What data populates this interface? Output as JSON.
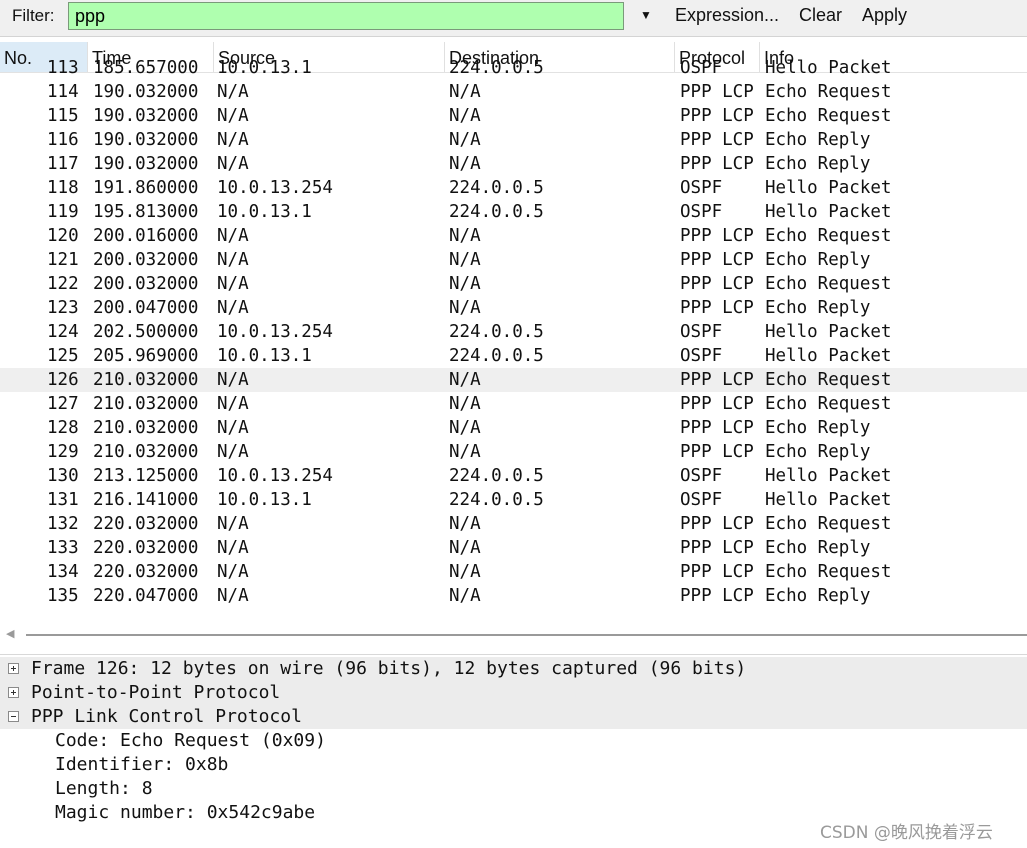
{
  "toolbar": {
    "filter_label": "Filter:",
    "filter_value": "ppp",
    "expression": "Expression...",
    "clear": "Clear",
    "apply": "Apply"
  },
  "columns": {
    "no": "No.",
    "time": "Time",
    "source": "Source",
    "destination": "Destination",
    "protocol": "Protocol",
    "info": "Info"
  },
  "packets": [
    {
      "no": "113",
      "time": "185.657000",
      "source": "10.0.13.1",
      "destination": "224.0.0.5",
      "protocol": "OSPF",
      "info": "Hello Packet"
    },
    {
      "no": "114",
      "time": "190.032000",
      "source": "N/A",
      "destination": "N/A",
      "protocol": "PPP LCP",
      "info": "Echo Request"
    },
    {
      "no": "115",
      "time": "190.032000",
      "source": "N/A",
      "destination": "N/A",
      "protocol": "PPP LCP",
      "info": "Echo Request"
    },
    {
      "no": "116",
      "time": "190.032000",
      "source": "N/A",
      "destination": "N/A",
      "protocol": "PPP LCP",
      "info": "Echo Reply"
    },
    {
      "no": "117",
      "time": "190.032000",
      "source": "N/A",
      "destination": "N/A",
      "protocol": "PPP LCP",
      "info": "Echo Reply"
    },
    {
      "no": "118",
      "time": "191.860000",
      "source": "10.0.13.254",
      "destination": "224.0.0.5",
      "protocol": "OSPF",
      "info": "Hello Packet"
    },
    {
      "no": "119",
      "time": "195.813000",
      "source": "10.0.13.1",
      "destination": "224.0.0.5",
      "protocol": "OSPF",
      "info": "Hello Packet"
    },
    {
      "no": "120",
      "time": "200.016000",
      "source": "N/A",
      "destination": "N/A",
      "protocol": "PPP LCP",
      "info": "Echo Request"
    },
    {
      "no": "121",
      "time": "200.032000",
      "source": "N/A",
      "destination": "N/A",
      "protocol": "PPP LCP",
      "info": "Echo Reply"
    },
    {
      "no": "122",
      "time": "200.032000",
      "source": "N/A",
      "destination": "N/A",
      "protocol": "PPP LCP",
      "info": "Echo Request"
    },
    {
      "no": "123",
      "time": "200.047000",
      "source": "N/A",
      "destination": "N/A",
      "protocol": "PPP LCP",
      "info": "Echo Reply"
    },
    {
      "no": "124",
      "time": "202.500000",
      "source": "10.0.13.254",
      "destination": "224.0.0.5",
      "protocol": "OSPF",
      "info": "Hello Packet"
    },
    {
      "no": "125",
      "time": "205.969000",
      "source": "10.0.13.1",
      "destination": "224.0.0.5",
      "protocol": "OSPF",
      "info": "Hello Packet"
    },
    {
      "no": "126",
      "time": "210.032000",
      "source": "N/A",
      "destination": "N/A",
      "protocol": "PPP LCP",
      "info": "Echo Request",
      "selected": true
    },
    {
      "no": "127",
      "time": "210.032000",
      "source": "N/A",
      "destination": "N/A",
      "protocol": "PPP LCP",
      "info": "Echo Request"
    },
    {
      "no": "128",
      "time": "210.032000",
      "source": "N/A",
      "destination": "N/A",
      "protocol": "PPP LCP",
      "info": "Echo Reply"
    },
    {
      "no": "129",
      "time": "210.032000",
      "source": "N/A",
      "destination": "N/A",
      "protocol": "PPP LCP",
      "info": "Echo Reply"
    },
    {
      "no": "130",
      "time": "213.125000",
      "source": "10.0.13.254",
      "destination": "224.0.0.5",
      "protocol": "OSPF",
      "info": "Hello Packet"
    },
    {
      "no": "131",
      "time": "216.141000",
      "source": "10.0.13.1",
      "destination": "224.0.0.5",
      "protocol": "OSPF",
      "info": "Hello Packet"
    },
    {
      "no": "132",
      "time": "220.032000",
      "source": "N/A",
      "destination": "N/A",
      "protocol": "PPP LCP",
      "info": "Echo Request"
    },
    {
      "no": "133",
      "time": "220.032000",
      "source": "N/A",
      "destination": "N/A",
      "protocol": "PPP LCP",
      "info": "Echo Reply"
    },
    {
      "no": "134",
      "time": "220.032000",
      "source": "N/A",
      "destination": "N/A",
      "protocol": "PPP LCP",
      "info": "Echo Request"
    },
    {
      "no": "135",
      "time": "220.047000",
      "source": "N/A",
      "destination": "N/A",
      "protocol": "PPP LCP",
      "info": "Echo Reply"
    }
  ],
  "details": [
    {
      "text": "Frame 126: 12 bytes on wire (96 bits), 12 bytes captured (96 bits)",
      "expanded": false
    },
    {
      "text": "Point-to-Point Protocol",
      "expanded": false
    },
    {
      "text": "PPP Link Control Protocol",
      "expanded": true,
      "children": [
        "Code: Echo Request (0x09)",
        "Identifier: 0x8b",
        "Length: 8",
        "Magic number: 0x542c9abe"
      ]
    }
  ],
  "watermark": "CSDN @晚风挽着浮云",
  "colors": {
    "filter_ok": "#afffaf",
    "selected_row": "#efefef",
    "header_active": "#dcebf7"
  }
}
